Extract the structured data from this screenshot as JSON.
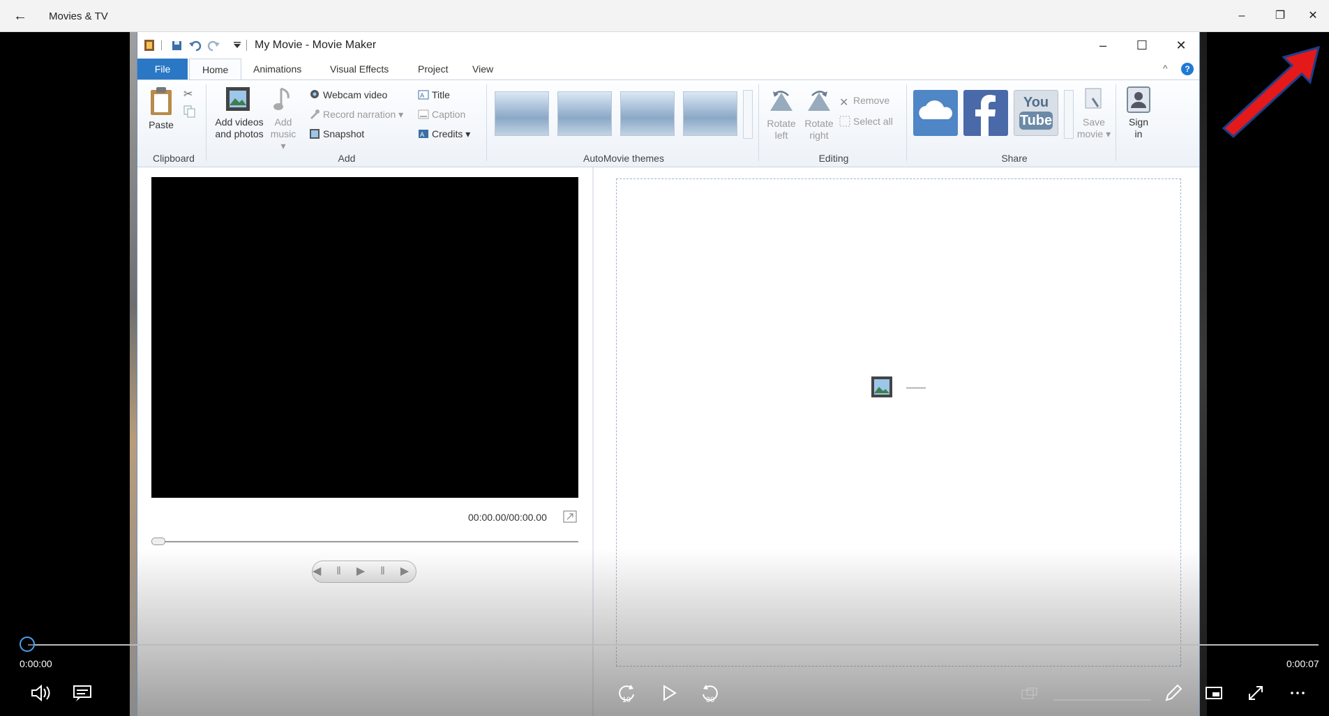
{
  "outer": {
    "back_glyph": "←",
    "app_title": "Movies & TV",
    "minimize": "–",
    "restore": "❐",
    "close": "✕"
  },
  "moviemaker": {
    "window_title": "My Movie - Movie Maker",
    "minimize": "–",
    "maximize": "☐",
    "close": "✕",
    "tabs": [
      "File",
      "Home",
      "Animations",
      "Visual Effects",
      "Project",
      "View"
    ],
    "help": "?",
    "collapse": "^",
    "clipboard": {
      "paste": "Paste",
      "label": "Clipboard"
    },
    "add": {
      "add_videos_line1": "Add videos",
      "add_videos_line2": "and photos",
      "add_music_line1": "Add",
      "add_music_line2": "music ▾",
      "webcam": "Webcam video",
      "narration": "Record narration ▾",
      "snapshot": "Snapshot",
      "title": "Title",
      "caption": "Caption",
      "credits": "Credits ▾",
      "label": "Add"
    },
    "themes": {
      "label": "AutoMovie themes"
    },
    "editing": {
      "rotate_left_1": "Rotate",
      "rotate_left_2": "left",
      "rotate_right_1": "Rotate",
      "rotate_right_2": "right",
      "remove": "Remove",
      "select_all": "Select all",
      "label": "Editing"
    },
    "share": {
      "youtube_1": "You",
      "youtube_2": "Tube",
      "save_movie_1": "Save",
      "save_movie_2": "movie ▾",
      "sign_in_1": "Sign",
      "sign_in_2": "in",
      "label": "Share"
    },
    "preview": {
      "time": "00:00.00/00:00.00"
    }
  },
  "player": {
    "position": "0:00:00",
    "duration": "0:00:07",
    "skip_back": "10",
    "skip_forward": "30",
    "progress_fraction": 0
  }
}
